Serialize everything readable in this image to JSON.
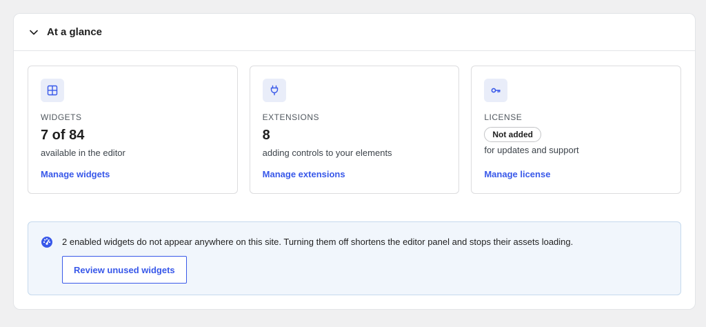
{
  "panel": {
    "title": "At a glance",
    "toggle_icon": "chevron-down-icon"
  },
  "cards": [
    {
      "icon": "grid-icon",
      "label": "WIDGETS",
      "value": "7 of 84",
      "description": "available in the editor",
      "link": "Manage widgets"
    },
    {
      "icon": "plug-icon",
      "label": "EXTENSIONS",
      "value": "8",
      "description": "adding controls to your elements",
      "link": "Manage extensions"
    },
    {
      "icon": "key-icon",
      "label": "LICENSE",
      "badge": "Not added",
      "description": "for updates and support",
      "link": "Manage license"
    }
  ],
  "notice": {
    "icon": "gauge-icon",
    "text": "2 enabled widgets do not appear anywhere on this site. Turning them off shortens the editor panel and stops their assets loading.",
    "button": "Review unused widgets"
  },
  "colors": {
    "accent": "#3858e9",
    "icon_bg": "#e9edf9",
    "notice_bg": "#f1f6fc",
    "page_bg": "#f0f0f1"
  }
}
